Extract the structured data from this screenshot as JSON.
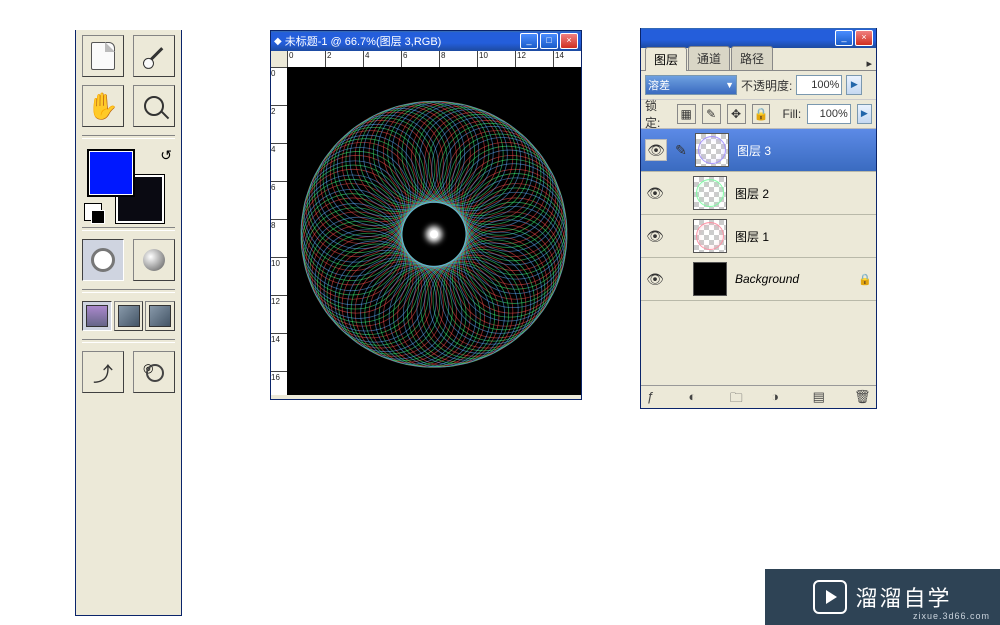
{
  "toolbox": {
    "tools": [
      {
        "name": "notes-tool",
        "icon": "note"
      },
      {
        "name": "eyedropper-tool",
        "icon": "eyedrop"
      },
      {
        "name": "hand-tool",
        "icon": "hand"
      },
      {
        "name": "zoom-tool",
        "icon": "zoom"
      }
    ],
    "quickmask": [
      {
        "name": "standard-mode",
        "icon": "circle-o"
      },
      {
        "name": "quickmask-mode",
        "icon": "circle"
      }
    ],
    "screenmodes": [
      {
        "name": "screenmode-standard",
        "icon": "sq",
        "active": true
      },
      {
        "name": "screenmode-full-menubar",
        "icon": "sq"
      },
      {
        "name": "screenmode-full",
        "icon": "sq"
      }
    ],
    "bottom": [
      {
        "name": "jump-to-imageready",
        "icon": "export"
      },
      {
        "name": "jump-to",
        "icon": "jump"
      }
    ],
    "swatch_swap": "↺"
  },
  "canvas": {
    "title": "未标题-1 @ 66.7%(图层 3,RGB)",
    "ruler_top": [
      "0",
      "2",
      "4",
      "6",
      "8",
      "10",
      "12",
      "14"
    ],
    "ruler_left": [
      "0",
      "2",
      "4",
      "6",
      "8",
      "10",
      "12",
      "14",
      "16"
    ]
  },
  "layers": {
    "tabs": [
      {
        "id": "layers",
        "label": "图层",
        "active": true
      },
      {
        "id": "channels",
        "label": "通道"
      },
      {
        "id": "paths",
        "label": "路径"
      }
    ],
    "blend_label": "溶差",
    "opacity_label": "不透明度:",
    "opacity_value": "100%",
    "lock_label": "锁定:",
    "fill_label": "Fill:",
    "fill_value": "100%",
    "items": [
      {
        "name": "图层 3",
        "thumb_tint": "rgba(160,140,255,0.35)",
        "selected": true,
        "brush": true
      },
      {
        "name": "图层 2",
        "thumb_tint": "rgba(120,255,160,0.35)"
      },
      {
        "name": "图层 1",
        "thumb_tint": "rgba(255,140,160,0.35)"
      },
      {
        "name": "Background",
        "thumb_solid": "#000",
        "italic": true,
        "locked": true
      }
    ],
    "bottom_icons": [
      "fx",
      "mask",
      "folder",
      "adjust",
      "new",
      "trash"
    ]
  },
  "watermark": {
    "brand": "溜溜自学",
    "sub": "zixue.3d66.com"
  }
}
